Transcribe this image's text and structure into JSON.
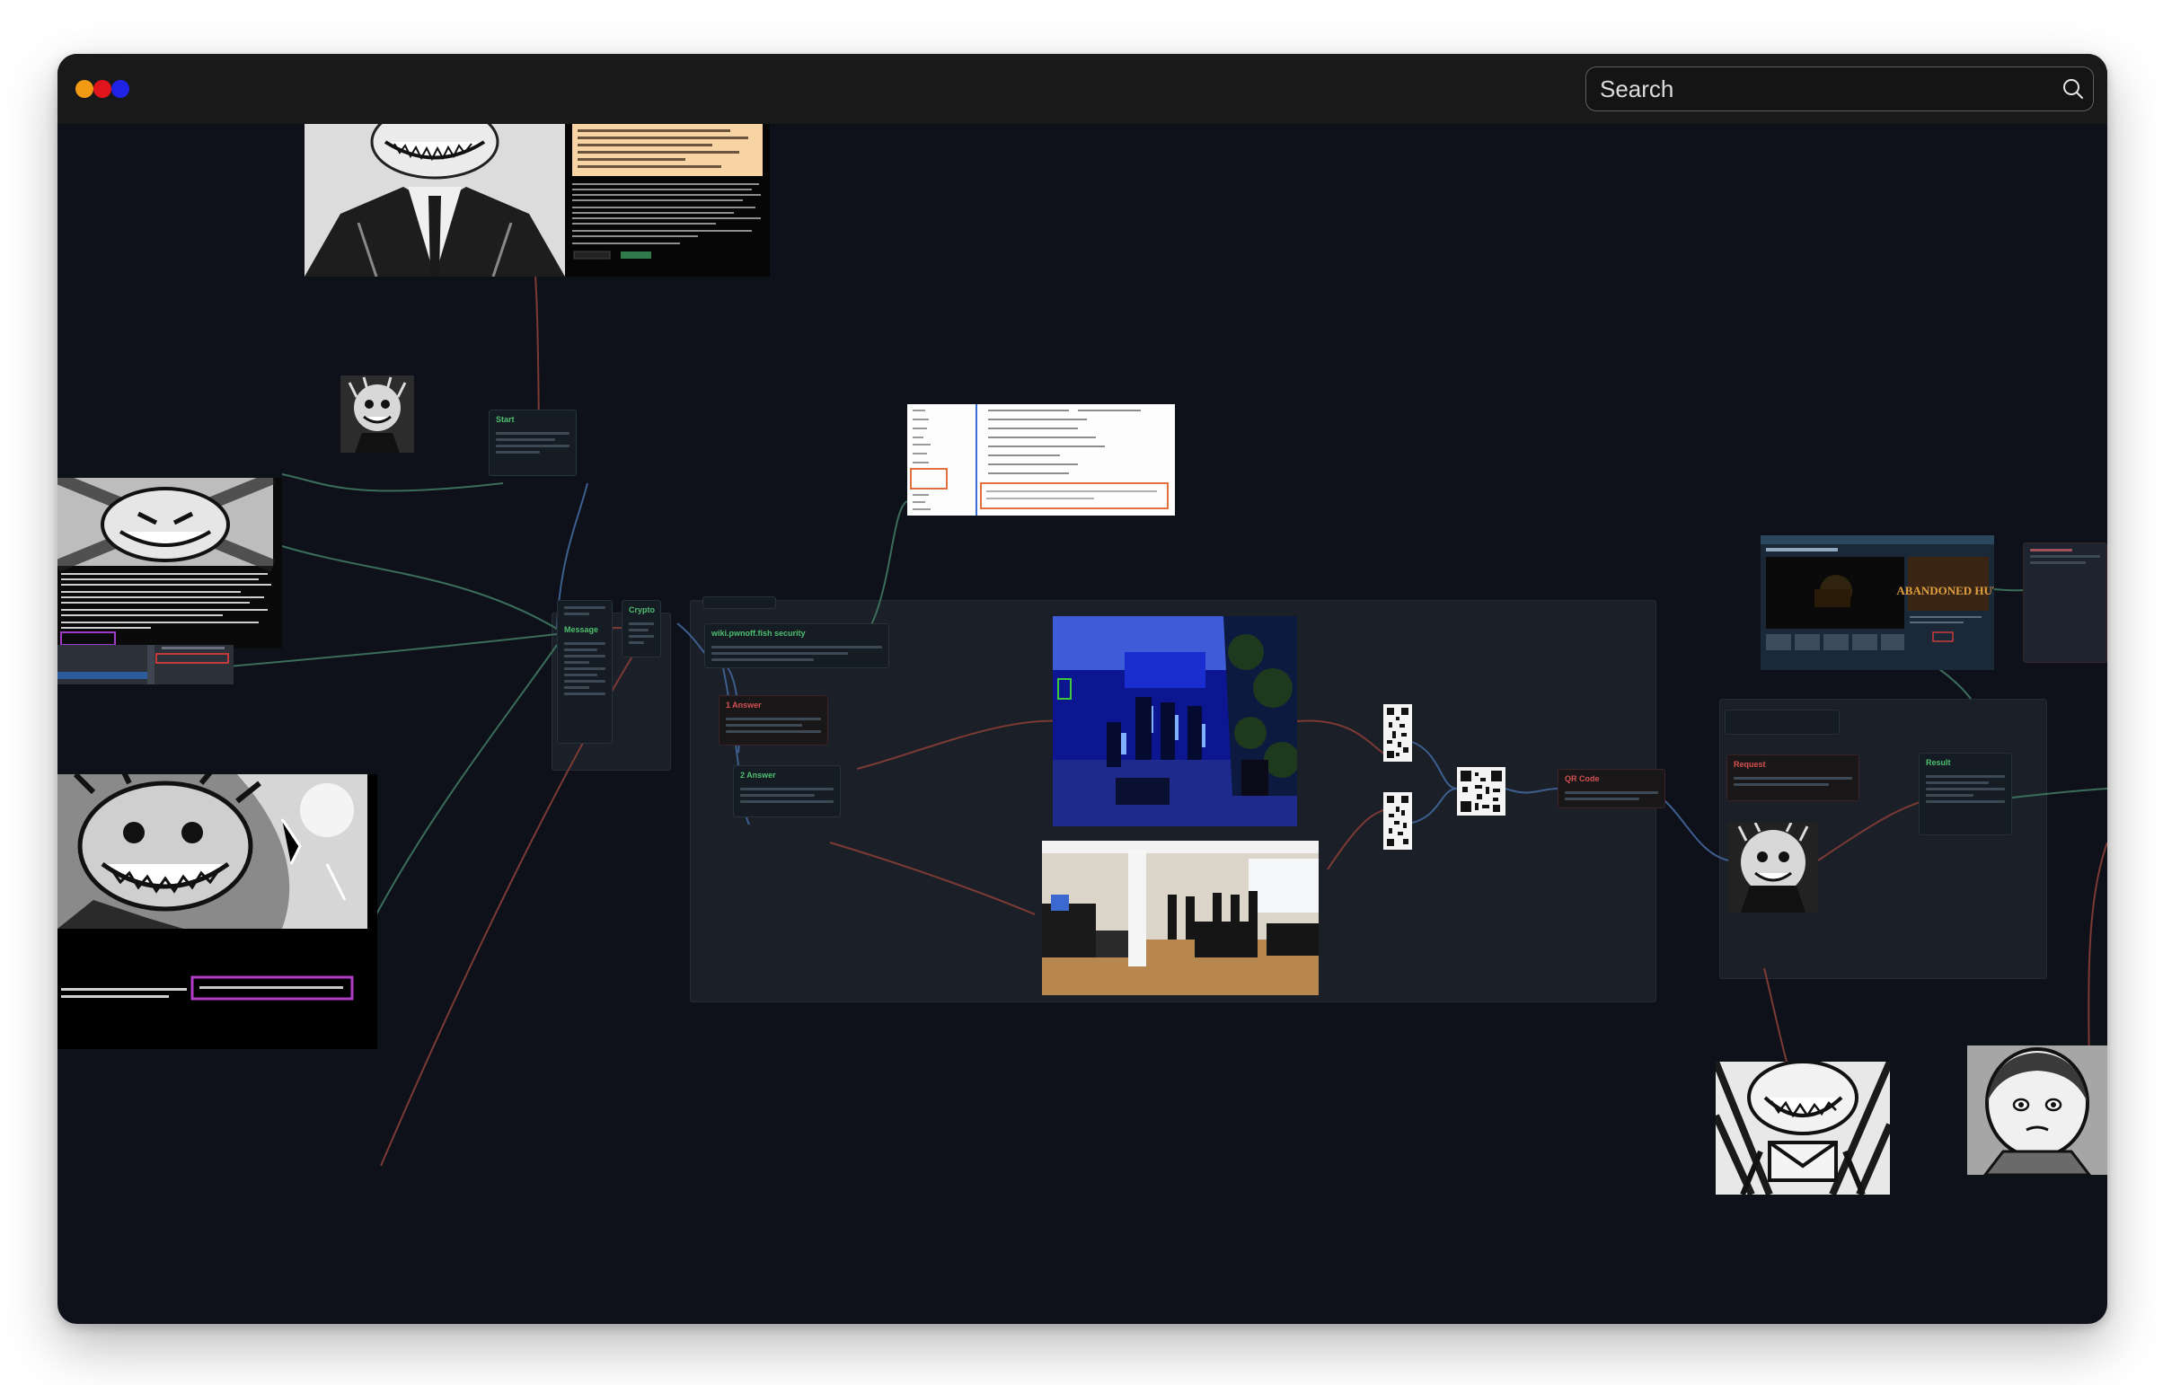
{
  "window": {
    "controls": [
      {
        "name": "minimize",
        "color": "#f39a14"
      },
      {
        "name": "close",
        "color": "#e3151c"
      },
      {
        "name": "maximize",
        "color": "#1f23e6"
      }
    ]
  },
  "search": {
    "placeholder": "Search",
    "icon": "search-icon"
  },
  "nodes": {
    "message_title": "Message",
    "crypto_title": "Crypto",
    "start_title": "Start",
    "security_title": "wiki.pwnoff.fish security",
    "answer1_title": "1 Answer",
    "answer2_title": "2 Answer",
    "qr_title": "QR Code",
    "request_title": "Request",
    "result_title": "Result"
  },
  "images": {
    "game_title": "ABANDONED HUT"
  },
  "colors": {
    "canvas_bg": "#0e111a",
    "titlebar_bg": "#191919",
    "green_title": "#4fbf6e",
    "red_title": "#d45050",
    "wire_green": "#3b6e5a",
    "wire_red": "#7b3a33",
    "wire_blue": "#3d5f8e"
  }
}
